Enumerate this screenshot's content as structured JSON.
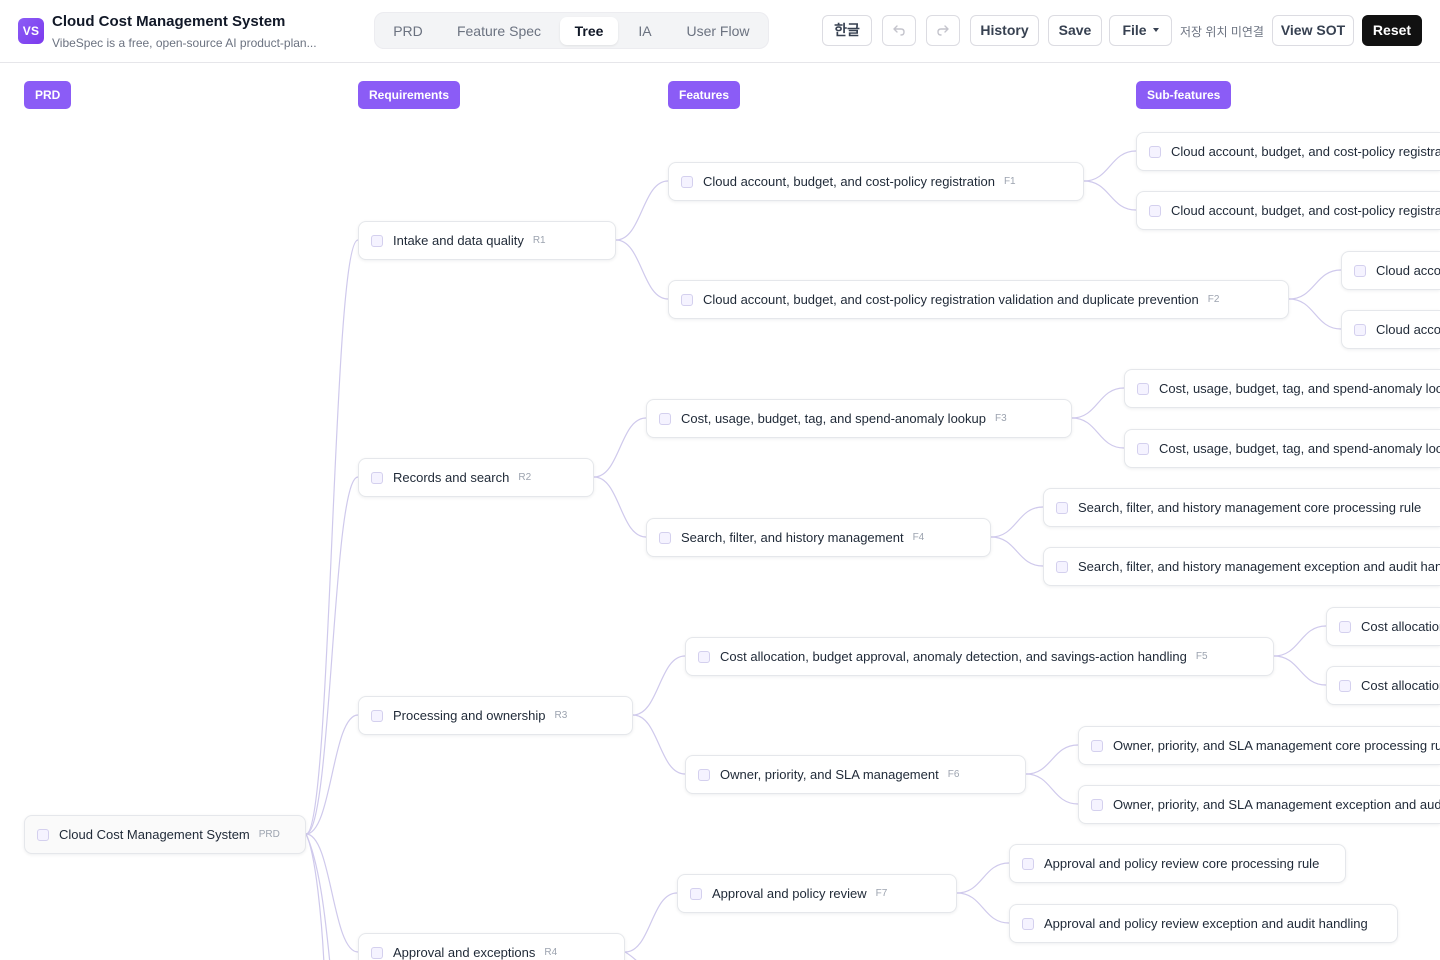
{
  "header": {
    "logo_text": "VS",
    "title": "Cloud Cost Management System",
    "subtitle": "VibeSpec is a free, open-source AI product-plan...",
    "tabs": [
      {
        "label": "PRD",
        "active": false
      },
      {
        "label": "Feature Spec",
        "active": false
      },
      {
        "label": "Tree",
        "active": true
      },
      {
        "label": "IA",
        "active": false
      },
      {
        "label": "User Flow",
        "active": false
      }
    ],
    "lang_label": "한글",
    "undo_icon": "undo-icon",
    "redo_icon": "redo-icon",
    "history_label": "History",
    "save_label": "Save",
    "file_label": "File",
    "save_location": "저장 위치 미연결",
    "view_sot_label": "View SOT",
    "reset_label": "Reset"
  },
  "columns": {
    "prd": "PRD",
    "requirements": "Requirements",
    "features": "Features",
    "subfeatures": "Sub-features"
  },
  "tree": {
    "root": {
      "label": "Cloud Cost Management System",
      "tag": "PRD"
    },
    "requirements": [
      {
        "label": "Intake and data quality",
        "tag": "R1"
      },
      {
        "label": "Records and search",
        "tag": "R2"
      },
      {
        "label": "Processing and ownership",
        "tag": "R3"
      },
      {
        "label": "Approval and exceptions",
        "tag": "R4"
      }
    ],
    "features": [
      {
        "label": "Cloud account, budget, and cost-policy registration",
        "tag": "F1"
      },
      {
        "label": "Cloud account, budget, and cost-policy registration validation and duplicate prevention",
        "tag": "F2"
      },
      {
        "label": "Cost, usage, budget, tag, and spend-anomaly lookup",
        "tag": "F3"
      },
      {
        "label": "Search, filter, and history management",
        "tag": "F4"
      },
      {
        "label": "Cost allocation, budget approval, anomaly detection, and savings-action handling",
        "tag": "F5"
      },
      {
        "label": "Owner, priority, and SLA management",
        "tag": "F6"
      },
      {
        "label": "Approval and policy review",
        "tag": "F7"
      }
    ],
    "subfeatures": [
      {
        "label": "Cloud account, budget, and cost-policy registration core processing rule"
      },
      {
        "label": "Cloud account, budget, and cost-policy registration exception and audit handling"
      },
      {
        "label": "Cloud account, budget, and cost-policy registration validation and duplicate prevention core processing rule"
      },
      {
        "label": "Cloud account, budget, and cost-policy registration validation and duplicate prevention exception and audit handling"
      },
      {
        "label": "Cost, usage, budget, tag, and spend-anomaly lookup core processing rule"
      },
      {
        "label": "Cost, usage, budget, tag, and spend-anomaly lookup exception and audit handling"
      },
      {
        "label": "Search, filter, and history management core processing rule"
      },
      {
        "label": "Search, filter, and history management exception and audit handling"
      },
      {
        "label": "Cost allocation, budget approval, anomaly detection, and savings-action handling core processing rule"
      },
      {
        "label": "Cost allocation, budget approval, anomaly detection, and savings-action handling exception and audit handling"
      },
      {
        "label": "Owner, priority, and SLA management core processing rule"
      },
      {
        "label": "Owner, priority, and SLA management exception and audit handling"
      },
      {
        "label": "Approval and policy review core processing rule"
      },
      {
        "label": "Approval and policy review exception and audit handling"
      }
    ]
  }
}
